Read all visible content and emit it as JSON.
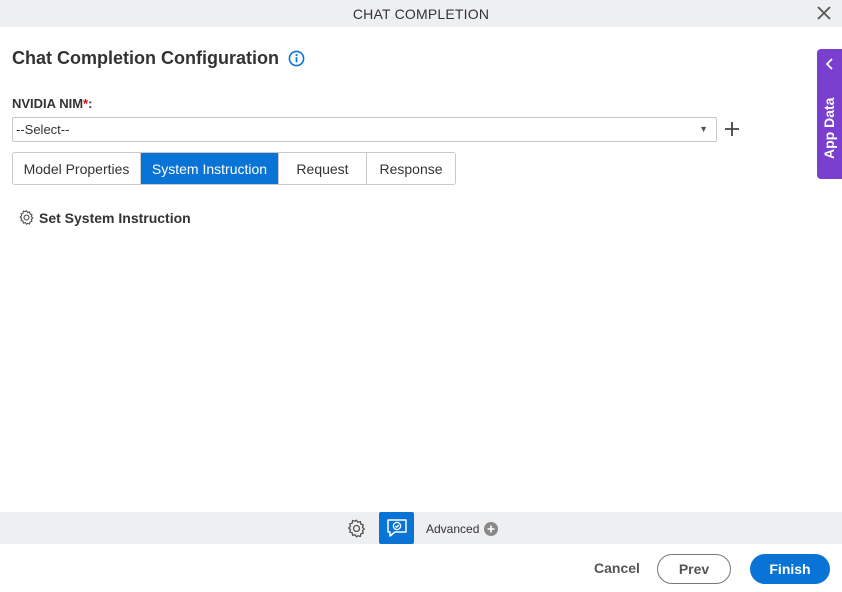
{
  "window": {
    "title": "CHAT COMPLETION",
    "close_icon": "close-icon"
  },
  "heading": {
    "title": "Chat Completion Configuration",
    "info_icon": "info-icon"
  },
  "nvidia_field": {
    "label": "NVIDIA NIM",
    "required_mark": "*",
    "colon": ":",
    "selected_value": "--Select--",
    "add_icon": "plus-icon"
  },
  "tabs": [
    {
      "label": "Model Properties",
      "active": false
    },
    {
      "label": "System Instruction",
      "active": true
    },
    {
      "label": "Request",
      "active": false
    },
    {
      "label": "Response",
      "active": false
    }
  ],
  "system_instruction": {
    "label": "Set System Instruction",
    "icon": "gear-icon"
  },
  "app_data_panel": {
    "label": "App Data",
    "icon": "chevron-left-icon"
  },
  "bottom_bar": {
    "advanced_label": "Advanced",
    "gear_icon": "gear-icon",
    "chat_icon": "chat-icon",
    "plus_icon": "plus-circle-icon"
  },
  "footer": {
    "cancel": "Cancel",
    "prev": "Prev",
    "finish": "Finish"
  },
  "colors": {
    "accent": "#0a74d6",
    "app_data": "#7b3fcf",
    "required": "#e00000"
  }
}
